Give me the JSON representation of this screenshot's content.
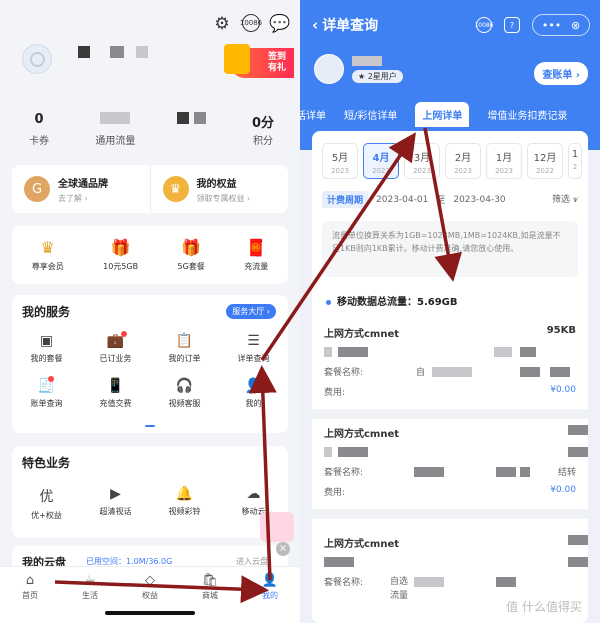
{
  "left": {
    "stats": [
      {
        "value": "0",
        "label": "卡券"
      },
      {
        "value": "",
        "label": "通用流量"
      },
      {
        "value": "",
        "label": ""
      },
      {
        "value": "0分",
        "label": "积分"
      }
    ],
    "checkin": {
      "line1": "签到",
      "line2": "有礼"
    },
    "brand": [
      {
        "title": "全球通品牌",
        "sub": "去了解 ›",
        "icon": "globe-badge-icon"
      },
      {
        "title": "我的权益",
        "sub": "领取专属权益 ›",
        "icon": "crown-icon"
      }
    ],
    "quick": [
      {
        "label": "尊享会员",
        "icon": "crown-icon"
      },
      {
        "label": "10元5GB",
        "icon": "gift-box-icon"
      },
      {
        "label": "5G套餐",
        "icon": "gift-box-icon"
      },
      {
        "label": "充流量",
        "icon": "red-envelope-icon"
      }
    ],
    "services": {
      "title": "我的服务",
      "hall_label": "服务大厅 ›",
      "items": [
        {
          "label": "我的套餐",
          "icon": "package-icon"
        },
        {
          "label": "已订业务",
          "icon": "briefcase-icon"
        },
        {
          "label": "我的订单",
          "icon": "clipboard-icon"
        },
        {
          "label": "详单查询",
          "icon": "list-doc-icon"
        },
        {
          "label": "账单查询",
          "icon": "bill-icon"
        },
        {
          "label": "充值交费",
          "icon": "phone-pay-icon"
        },
        {
          "label": "视频客服",
          "icon": "video-service-icon"
        },
        {
          "label": "我的",
          "icon": "user-doc-icon"
        }
      ]
    },
    "special": {
      "title": "特色业务",
      "items": [
        {
          "label": "优+权益",
          "icon": "plus-rights-icon"
        },
        {
          "label": "超清视话",
          "icon": "hd-video-icon"
        },
        {
          "label": "视频彩铃",
          "icon": "bell-icon"
        },
        {
          "label": "移动云",
          "icon": "cloud-icon"
        }
      ]
    },
    "cloud": {
      "title": "我的云盘",
      "usage": "已用空间：1.0M/36.0G",
      "go": "进入云盘"
    },
    "tabbar": [
      {
        "label": "首页",
        "icon": "home-icon"
      },
      {
        "label": "生活",
        "icon": "cup-icon"
      },
      {
        "label": "权益",
        "icon": "diamond-icon"
      },
      {
        "label": "商城",
        "icon": "shop-icon"
      },
      {
        "label": "我的",
        "icon": "user-icon",
        "active": true
      }
    ]
  },
  "right": {
    "title": "详单查询",
    "member_level": "2星用户",
    "bill_button": "查账单 ›",
    "tabs": [
      {
        "label": "话详单"
      },
      {
        "label": "短/彩信详单"
      },
      {
        "label": "上网详单",
        "active": true
      },
      {
        "label": "增值业务扣费记录"
      }
    ],
    "months": [
      {
        "m": "5月",
        "y": "2023"
      },
      {
        "m": "4月",
        "y": "2023",
        "active": true
      },
      {
        "m": "3月",
        "y": "2023"
      },
      {
        "m": "2月",
        "y": "2023"
      },
      {
        "m": "1月",
        "y": "2023"
      },
      {
        "m": "12月",
        "y": "2022"
      },
      {
        "m": "1",
        "y": "2"
      }
    ],
    "period_label": "计费周期",
    "period_start": "2023-04-01",
    "period_sep": "至",
    "period_end": "2023-04-30",
    "filter": "筛选",
    "notice": "流量单位换算关系为1GB=1024MB,1MB=1024KB,如是流量不足1KB则向1KB累计。移动计费准确,请您放心使用。",
    "total": "移动数据总流量：5.69GB",
    "records": [
      {
        "method": "上网方式cmnet",
        "amount": "95KB",
        "plan_label": "套餐名称:",
        "plan_value": "自",
        "fee_label": "费用:",
        "fee": "¥0.00"
      },
      {
        "method": "上网方式cmnet",
        "amount": "",
        "plan_label": "套餐名称:",
        "plan_value": "结转",
        "fee_label": "费用:",
        "fee": "¥0.00"
      },
      {
        "method": "上网方式cmnet",
        "amount": "",
        "plan_label": "套餐名称:",
        "plan_value": "自选",
        "plan_value2": "流量",
        "fee_label": "",
        "fee": ""
      }
    ],
    "watermark": "值 什么值得买"
  },
  "colors": {
    "accent": "#3f80f3",
    "arrow": "#8b1a1a"
  }
}
